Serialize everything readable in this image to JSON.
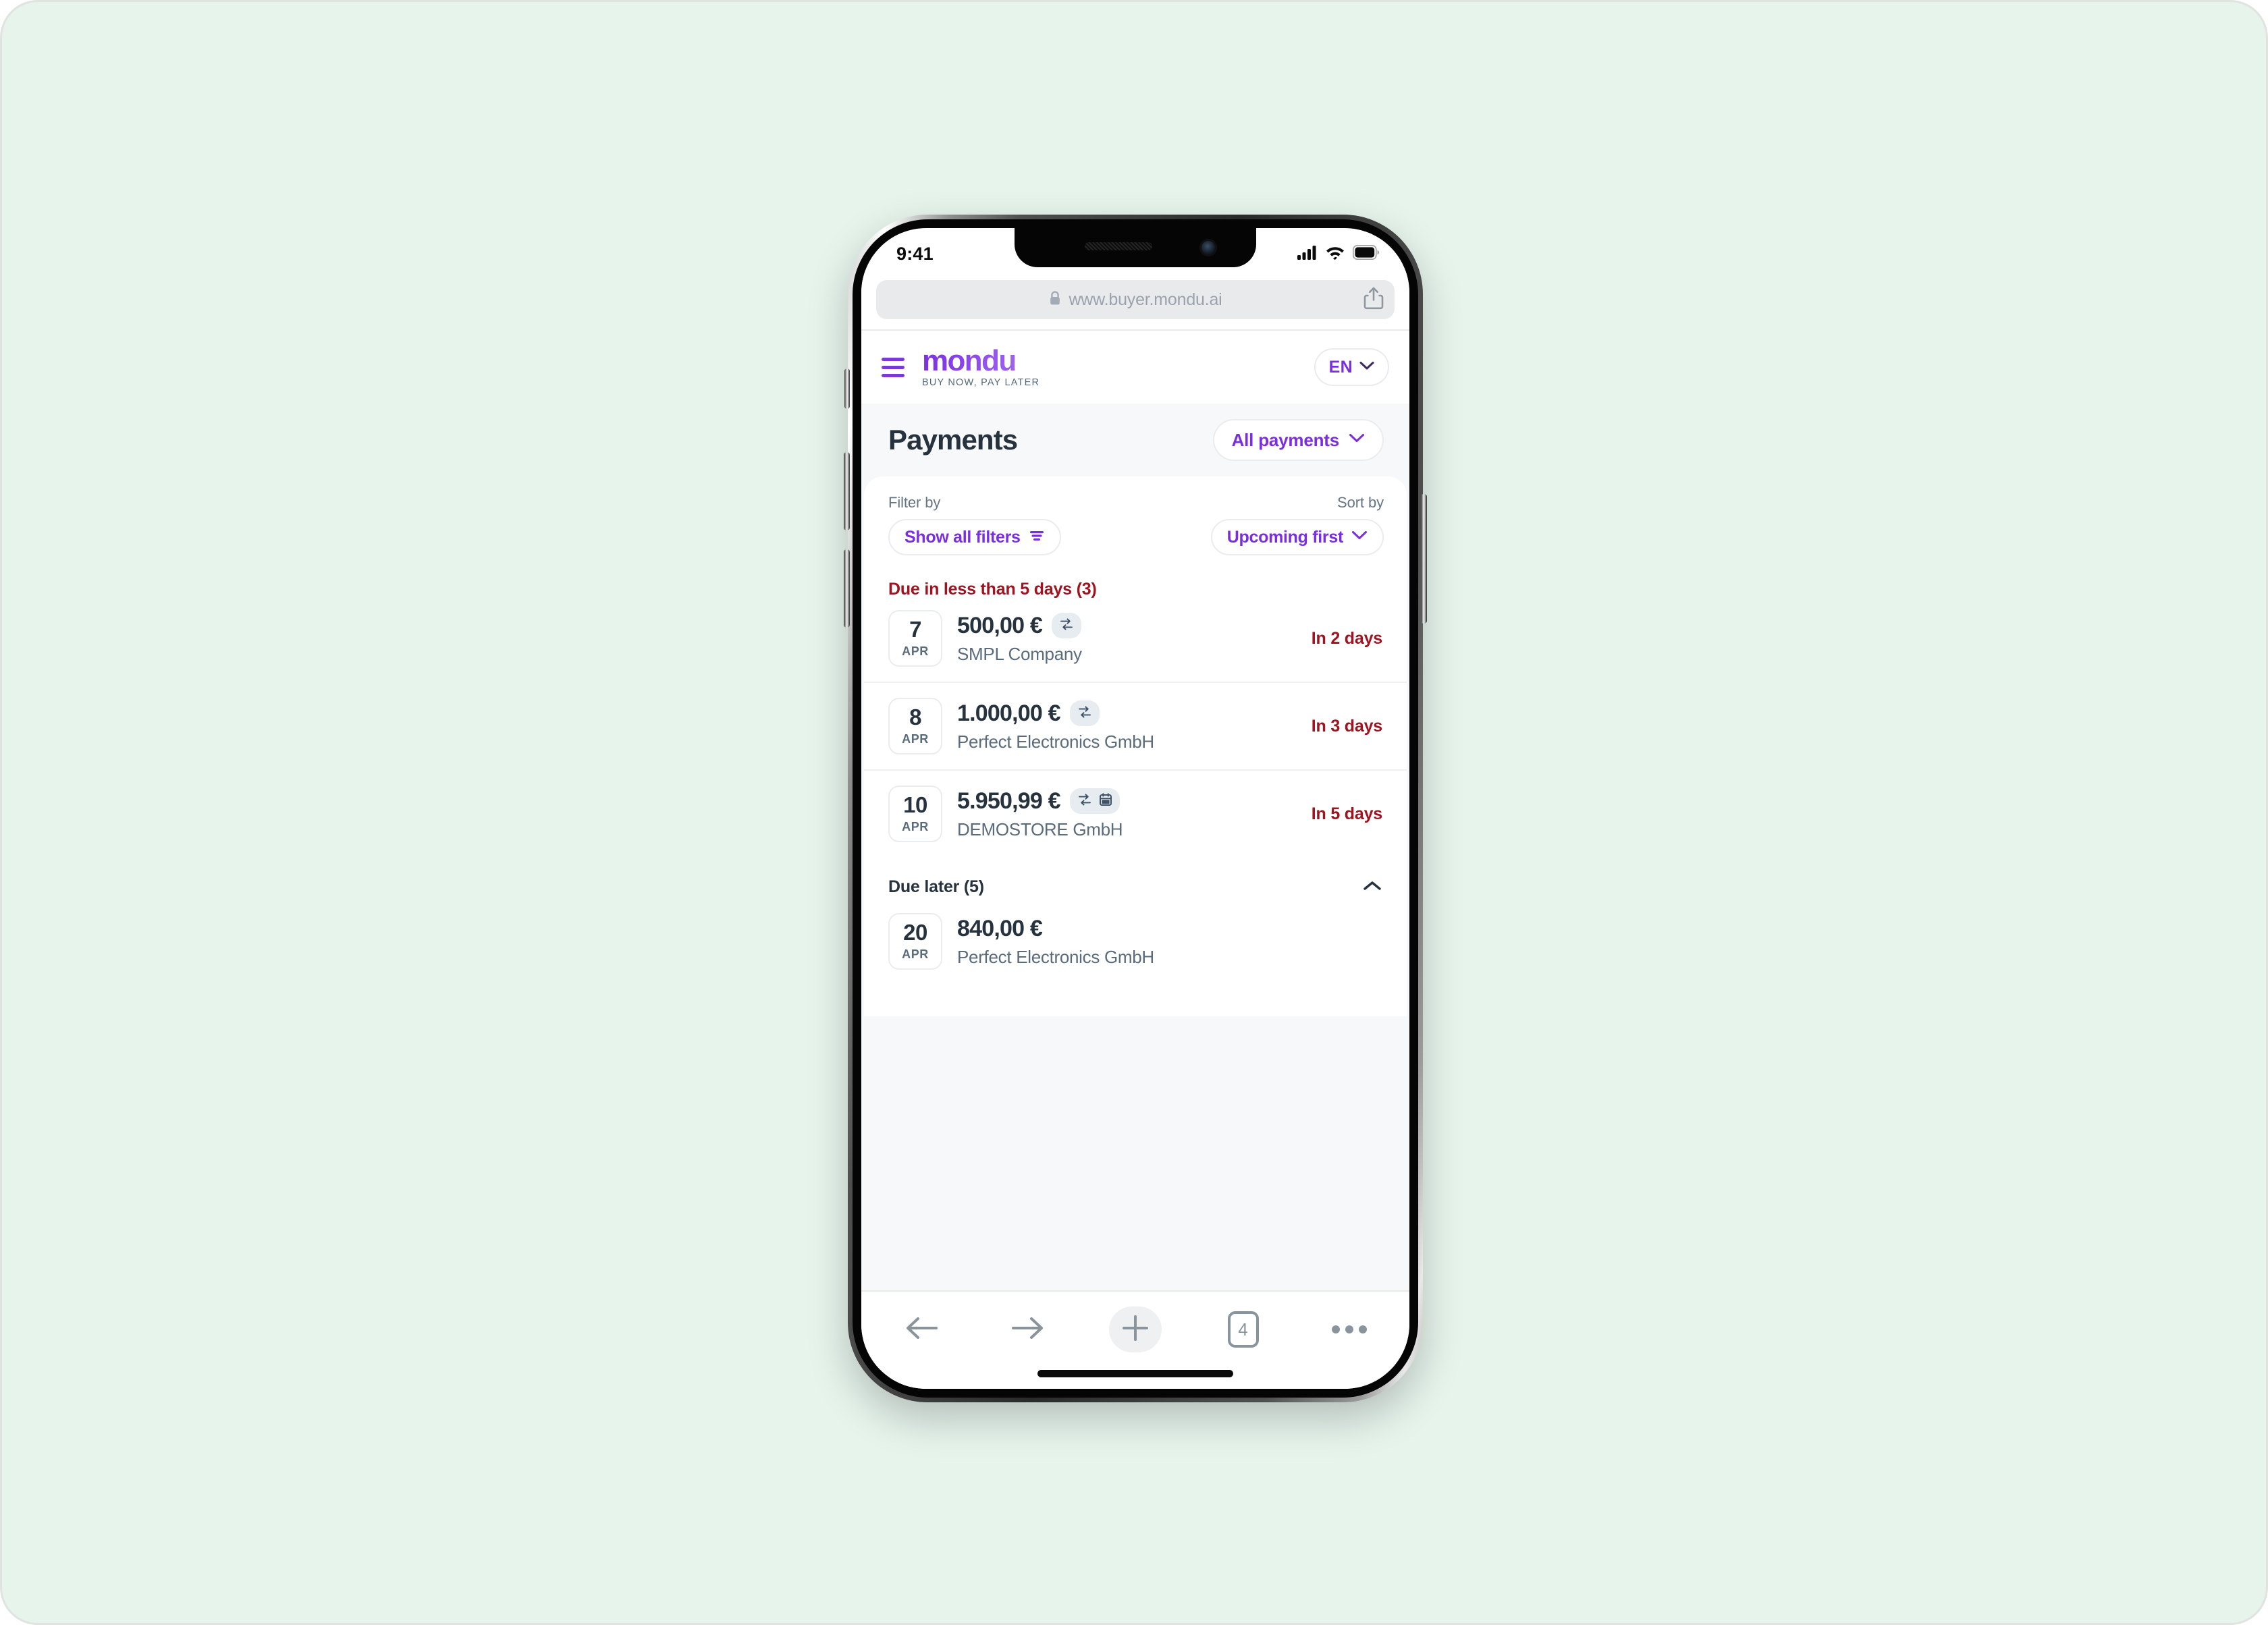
{
  "canvas": {
    "background_color": "#e6f4ec"
  },
  "status_bar": {
    "time": "9:41",
    "icons": [
      "cellular-signal-icon",
      "wifi-icon",
      "battery-icon"
    ]
  },
  "browser": {
    "url": "www.buyer.mondu.ai",
    "lock_icon": "lock-icon",
    "share_icon": "share-icon",
    "toolbar": {
      "back_icon": "arrow-left-icon",
      "forward_icon": "arrow-right-icon",
      "new_tab_icon": "plus-icon",
      "tab_count": "4",
      "more_icon": "ellipsis-icon"
    }
  },
  "site_header": {
    "menu_icon": "hamburger-menu-icon",
    "brand_name": "mondu",
    "brand_tagline": "BUY NOW, PAY LATER",
    "language": "EN",
    "language_chevron_icon": "chevron-down-icon",
    "brand_color": "#7a2ee0"
  },
  "page_header": {
    "title": "Payments",
    "scope_selector_label": "All payments",
    "scope_chevron_icon": "chevron-down-icon"
  },
  "controls": {
    "filter_caption": "Filter by",
    "filter_button_label": "Show all filters",
    "filter_icon": "filter-lines-icon",
    "sort_caption": "Sort by",
    "sort_button_label": "Upcoming first",
    "sort_chevron_icon": "chevron-down-icon"
  },
  "sections": [
    {
      "title": "Due in less than 5 days (3)",
      "style": "danger",
      "collapsible": false,
      "rows": [
        {
          "day": "7",
          "month": "APR",
          "amount": "500,00 €",
          "merchant": "SMPL Company",
          "due": "In 2 days",
          "badges": [
            "repeat-icon"
          ]
        },
        {
          "day": "8",
          "month": "APR",
          "amount": "1.000,00 €",
          "merchant": "Perfect Electronics GmbH",
          "due": "In 3 days",
          "badges": [
            "repeat-icon"
          ]
        },
        {
          "day": "10",
          "month": "APR",
          "amount": "5.950,99 €",
          "merchant": "DEMOSTORE GmbH",
          "due": "In 5 days",
          "badges": [
            "repeat-icon",
            "calendar-icon"
          ]
        }
      ]
    },
    {
      "title": "Due later (5)",
      "style": "neutral",
      "collapsible": true,
      "collapse_icon": "chevron-up-icon",
      "rows": [
        {
          "day": "20",
          "month": "APR",
          "amount": "840,00 €",
          "merchant": "Perfect Electronics GmbH",
          "due": "",
          "badges": []
        }
      ]
    }
  ],
  "colors": {
    "accent_purple": "#7a2ee0",
    "danger_red": "#9e1420",
    "text_dark": "#26323d",
    "text_muted": "#5a6b7c",
    "page_bg": "#f7f8f9"
  }
}
